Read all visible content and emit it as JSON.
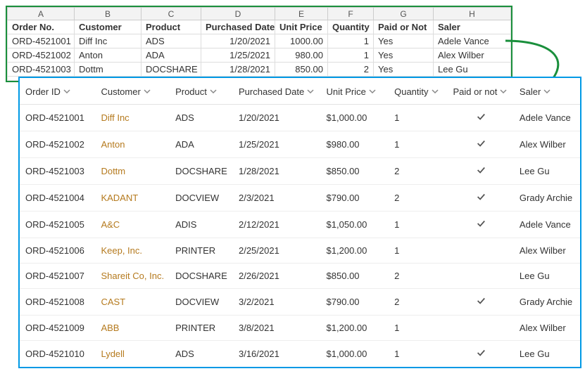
{
  "excel": {
    "col_letters": [
      "A",
      "B",
      "C",
      "D",
      "E",
      "F",
      "G",
      "H"
    ],
    "headers": [
      "Order No.",
      "Customer",
      "Product",
      "Purchased Date",
      "Unit Price",
      "Quantity",
      "Paid or Not",
      "Saler"
    ],
    "rows": [
      {
        "order": "ORD-4521001",
        "customer": "Diff Inc",
        "product": "ADS",
        "date": "1/20/2021",
        "price": "1000.00",
        "qty": "1",
        "paid": "Yes",
        "saler": "Adele Vance"
      },
      {
        "order": "ORD-4521002",
        "customer": "Anton",
        "product": "ADA",
        "date": "1/25/2021",
        "price": "980.00",
        "qty": "1",
        "paid": "Yes",
        "saler": "Alex Wilber"
      },
      {
        "order": "ORD-4521003",
        "customer": "Dottm",
        "product": "DOCSHARE",
        "date": "1/28/2021",
        "price": "850.00",
        "qty": "2",
        "paid": "Yes",
        "saler": "Lee Gu"
      }
    ]
  },
  "grid": {
    "headers": [
      "Order ID",
      "Customer",
      "Product",
      "Purchased Date",
      "Unit Price",
      "Quantity",
      "Paid or not",
      "Saler"
    ],
    "rows": [
      {
        "order": "ORD-4521001",
        "customer": "Diff Inc",
        "product": "ADS",
        "date": "1/20/2021",
        "price": "$1,000.00",
        "qty": "1",
        "paid": true,
        "saler": "Adele Vance"
      },
      {
        "order": "ORD-4521002",
        "customer": "Anton",
        "product": "ADA",
        "date": "1/25/2021",
        "price": "$980.00",
        "qty": "1",
        "paid": true,
        "saler": "Alex Wilber"
      },
      {
        "order": "ORD-4521003",
        "customer": "Dottm",
        "product": "DOCSHARE",
        "date": "1/28/2021",
        "price": "$850.00",
        "qty": "2",
        "paid": true,
        "saler": "Lee Gu"
      },
      {
        "order": "ORD-4521004",
        "customer": "KADANT",
        "product": "DOCVIEW",
        "date": "2/3/2021",
        "price": "$790.00",
        "qty": "2",
        "paid": true,
        "saler": "Grady Archie"
      },
      {
        "order": "ORD-4521005",
        "customer": "A&C",
        "product": "ADIS",
        "date": "2/12/2021",
        "price": "$1,050.00",
        "qty": "1",
        "paid": true,
        "saler": "Adele Vance"
      },
      {
        "order": "ORD-4521006",
        "customer": "Keep, Inc.",
        "product": "PRINTER",
        "date": "2/25/2021",
        "price": "$1,200.00",
        "qty": "1",
        "paid": false,
        "saler": "Alex Wilber"
      },
      {
        "order": "ORD-4521007",
        "customer": "Shareit Co, Inc.",
        "product": "DOCSHARE",
        "date": "2/26/2021",
        "price": "$850.00",
        "qty": "2",
        "paid": false,
        "saler": "Lee Gu"
      },
      {
        "order": "ORD-4521008",
        "customer": "CAST",
        "product": "DOCVIEW",
        "date": "3/2/2021",
        "price": "$790.00",
        "qty": "2",
        "paid": true,
        "saler": "Grady Archie"
      },
      {
        "order": "ORD-4521009",
        "customer": "ABB",
        "product": "PRINTER",
        "date": "3/8/2021",
        "price": "$1,200.00",
        "qty": "1",
        "paid": false,
        "saler": "Alex Wilber"
      },
      {
        "order": "ORD-4521010",
        "customer": "Lydell",
        "product": "ADS",
        "date": "3/16/2021",
        "price": "$1,000.00",
        "qty": "1",
        "paid": true,
        "saler": "Lee Gu"
      }
    ]
  }
}
